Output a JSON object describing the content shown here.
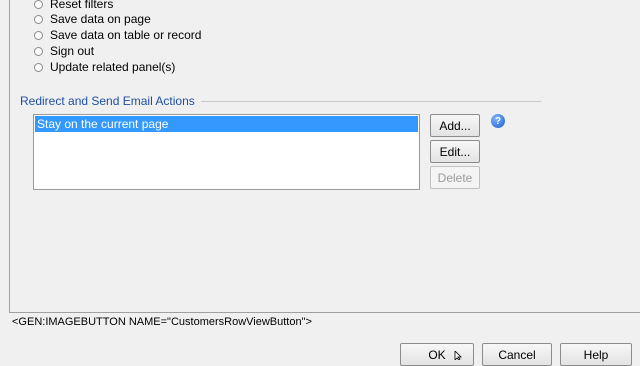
{
  "action_options": [
    {
      "label": "Reset filters"
    },
    {
      "label": "Save data on page"
    },
    {
      "label": "Save data on table or record"
    },
    {
      "label": "Sign out"
    },
    {
      "label": "Update related panel(s)"
    }
  ],
  "redirect_group": {
    "title": "Redirect and Send Email Actions",
    "list_items": [
      "Stay on the current page"
    ],
    "add_label": "Add...",
    "edit_label": "Edit...",
    "delete_label": "Delete",
    "help_glyph": "?"
  },
  "status_text": "<GEN:IMAGEBUTTON NAME=\"CustomersRowViewButton\">",
  "footer": {
    "ok_label": "OK",
    "cancel_label": "Cancel",
    "help_label": "Help"
  },
  "colors": {
    "selection": "#3399ff",
    "group_title": "#1f4fa3",
    "help_icon": "#1a5fd1"
  },
  "icons": {
    "help": "help-icon",
    "cursor": "mouse-cursor-icon"
  }
}
